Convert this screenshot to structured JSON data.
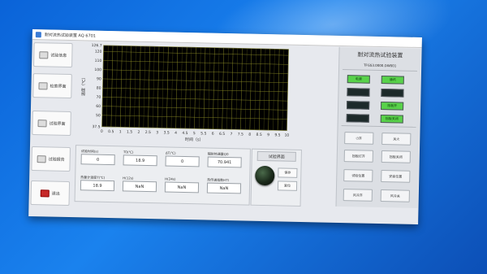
{
  "window": {
    "title": "耐对流热试验装置 AQ 6701"
  },
  "left_buttons": [
    {
      "label": "试验信息",
      "icon": "document-icon"
    },
    {
      "label": "检索界面",
      "icon": "search-icon"
    },
    {
      "label": "试验界面",
      "icon": "gear-icon"
    },
    {
      "label": "试验报告",
      "icon": "printer-icon"
    },
    {
      "label": "退出",
      "icon": "exit-icon"
    }
  ],
  "chart_data": {
    "type": "line",
    "xlabel": "时间（s）",
    "ylabel": "温度（℃）",
    "x_ticks": [
      "0",
      "0.5",
      "1",
      "1.5",
      "2",
      "2.5",
      "3",
      "3.5",
      "4",
      "4.5",
      "5",
      "5.5",
      "6",
      "6.5",
      "7",
      "7.5",
      "8",
      "8.5",
      "9",
      "9.5",
      "10"
    ],
    "y_ticks": [
      "37.5",
      "50",
      "60",
      "70",
      "80",
      "90",
      "100",
      "110",
      "120",
      "126.7"
    ],
    "xlim": [
      0,
      10
    ],
    "ylim": [
      37.5,
      126.7
    ],
    "grid": true,
    "series": []
  },
  "fields": [
    {
      "label": "试验时间(s)",
      "value": "0"
    },
    {
      "label": "T0(℃)",
      "value": "18.9"
    },
    {
      "label": "ΔT(℃)",
      "value": "0"
    },
    {
      "label": "辐射热通量Q0",
      "value": "70.941"
    },
    {
      "label": "热量计温度T(℃)",
      "value": "18.9"
    },
    {
      "label": "H(12s)",
      "value": "NaN"
    },
    {
      "label": "H(24s)",
      "value": "NaN"
    },
    {
      "label": "热传递指数HTI",
      "value": "NaN"
    }
  ],
  "control_panel": {
    "title": "试验界面",
    "save_label": "保存",
    "reset_label": "复位"
  },
  "right_panel": {
    "title": "耐对流热试验装置",
    "model": "TFGS3.0000.DW001",
    "indicators": [
      {
        "label": "电源",
        "color": "#58d24a"
      },
      {
        "label": "通讯",
        "color": "#58d24a"
      },
      {
        "label": "",
        "color": "#1d2a2a"
      },
      {
        "label": "",
        "color": "#1d2a2a"
      },
      {
        "label": "",
        "color": "#1d2a2a"
      },
      {
        "label": "挡板开",
        "color": "#58d24a"
      },
      {
        "label": "",
        "color": "#1d2a2a"
      },
      {
        "label": "挡板关闭",
        "color": "#58d24a"
      }
    ],
    "buttons": [
      {
        "label": "开",
        "icon": "power-icon"
      },
      {
        "label": "关火"
      },
      {
        "label": "挡板打开"
      },
      {
        "label": "挡板关闭"
      },
      {
        "label": "试验位置"
      },
      {
        "label": "安装位置"
      },
      {
        "label": "风冷开"
      },
      {
        "label": "风冷关"
      }
    ]
  }
}
